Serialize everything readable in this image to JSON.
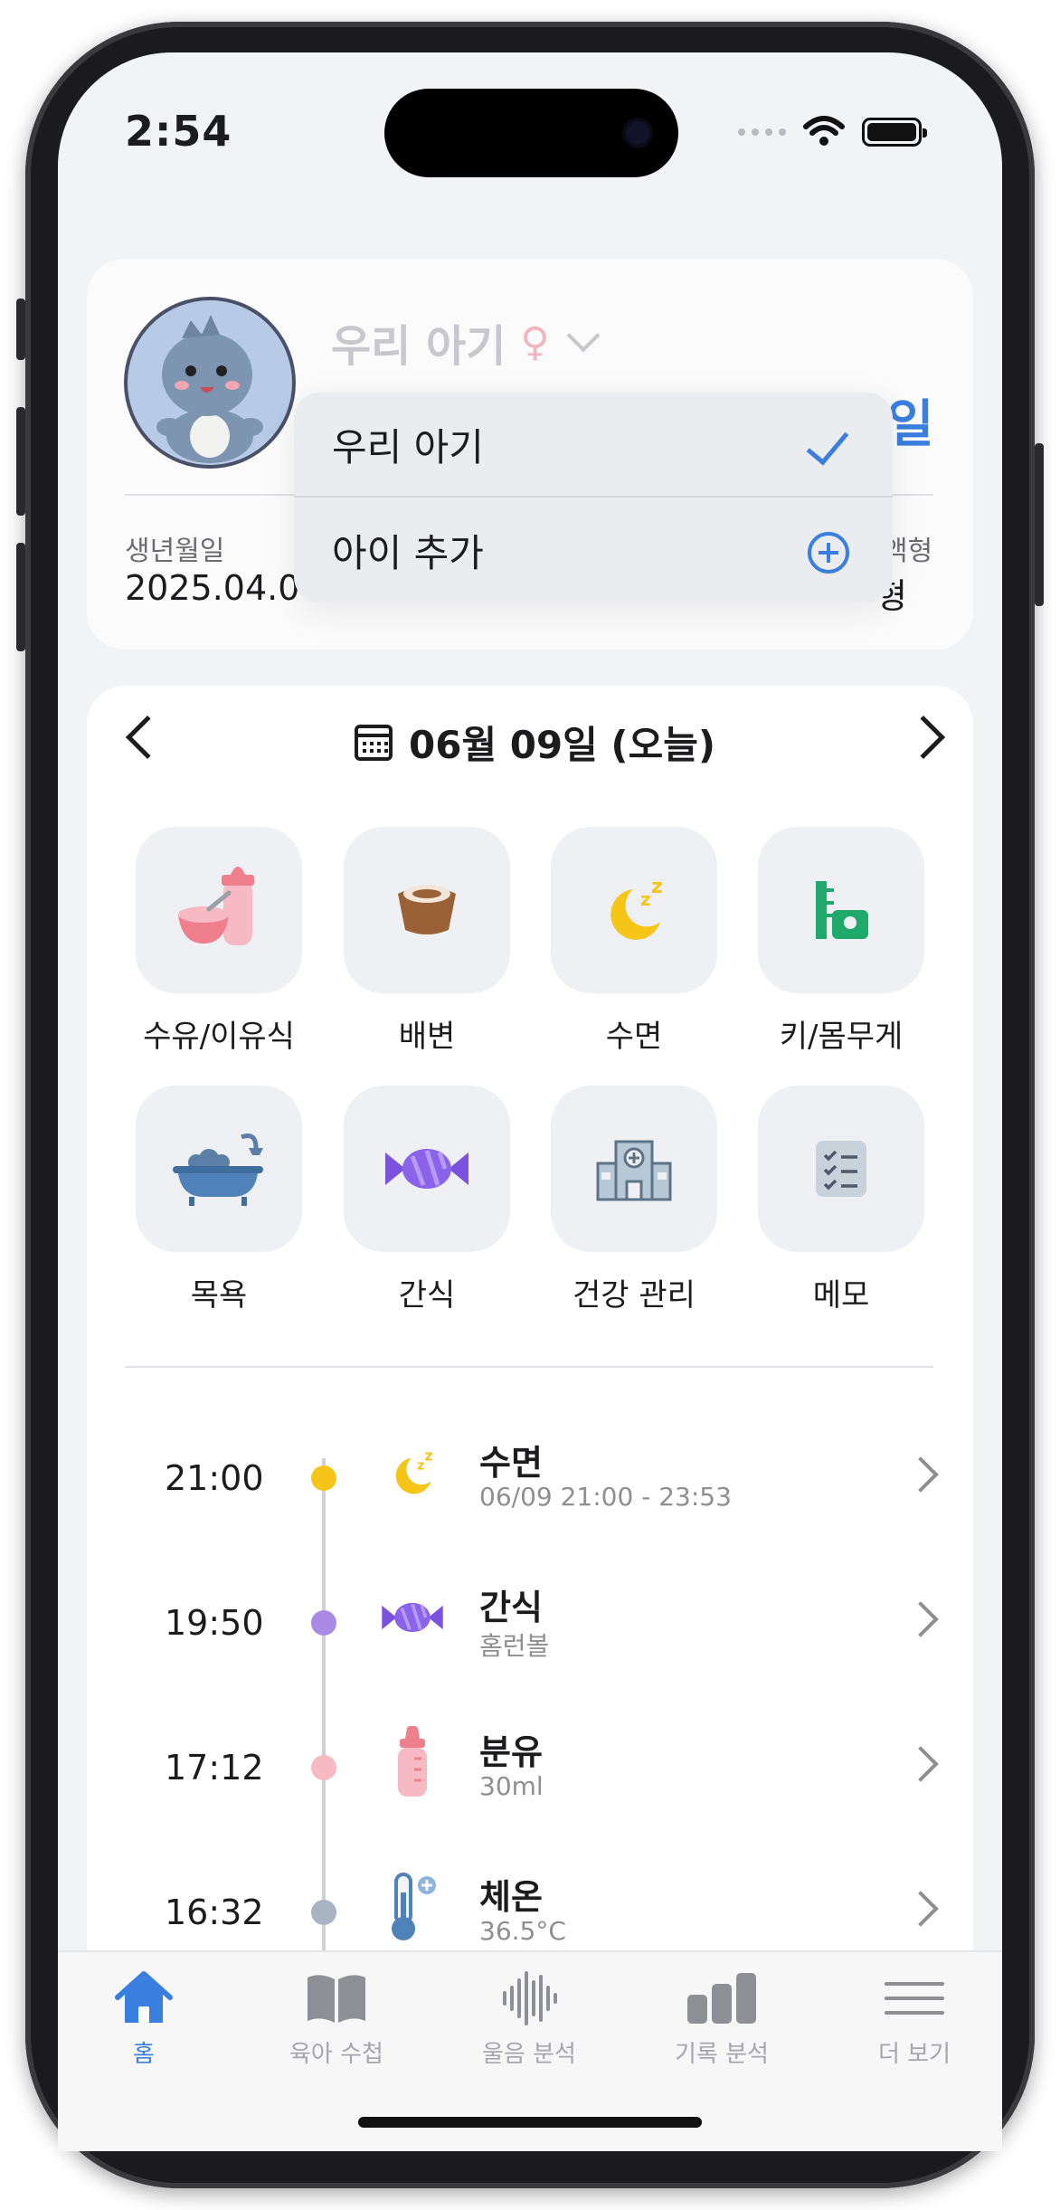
{
  "status": {
    "time": "2:54"
  },
  "profile": {
    "name": "우리 아기",
    "gender_symbol": "♀",
    "days_fragment": "일",
    "birth_label": "생년월일",
    "birth_value": "2025.04.0",
    "blood_label": "액형",
    "blood_value": "형"
  },
  "dropdown": {
    "items": [
      {
        "label": "우리 아기",
        "icon": "checkmark-icon"
      },
      {
        "label": "아이 추가",
        "icon": "plus-circle-icon"
      }
    ]
  },
  "date_nav": {
    "title": "06월 09일 (오늘)"
  },
  "categories": [
    {
      "label": "수유/이유식",
      "icon": "feeding-icon"
    },
    {
      "label": "배변",
      "icon": "potty-icon"
    },
    {
      "label": "수면",
      "icon": "sleep-icon"
    },
    {
      "label": "키/몸무게",
      "icon": "growth-icon"
    },
    {
      "label": "목욕",
      "icon": "bathtub-icon"
    },
    {
      "label": "간식",
      "icon": "candy-icon"
    },
    {
      "label": "건강 관리",
      "icon": "hospital-icon"
    },
    {
      "label": "메모",
      "icon": "memo-icon"
    }
  ],
  "timeline": [
    {
      "time": "21:00",
      "title": "수면",
      "sub": "06/09 21:00 - 23:53",
      "dot": "#f5c518",
      "icon": "sleep-icon"
    },
    {
      "time": "19:50",
      "title": "간식",
      "sub": "홈런볼",
      "dot": "#a98be6",
      "icon": "candy-icon"
    },
    {
      "time": "17:12",
      "title": "분유",
      "sub": "30ml",
      "dot": "#f7b9c2",
      "icon": "baby-bottle-icon"
    },
    {
      "time": "16:32",
      "title": "체온",
      "sub": "36.5°C",
      "dot": "#a8b4c2",
      "icon": "thermometer-icon"
    }
  ],
  "tabs": [
    {
      "label": "홈",
      "icon": "home-icon",
      "active": true
    },
    {
      "label": "육아 수첩",
      "icon": "book-icon",
      "active": false
    },
    {
      "label": "울음 분석",
      "icon": "waveform-icon",
      "active": false
    },
    {
      "label": "기록 분석",
      "icon": "bar-chart-icon",
      "active": false
    },
    {
      "label": "더 보기",
      "icon": "menu-icon",
      "active": false
    }
  ],
  "colors": {
    "accent": "#3a7fe0",
    "inactive": "#a5a6ab"
  }
}
